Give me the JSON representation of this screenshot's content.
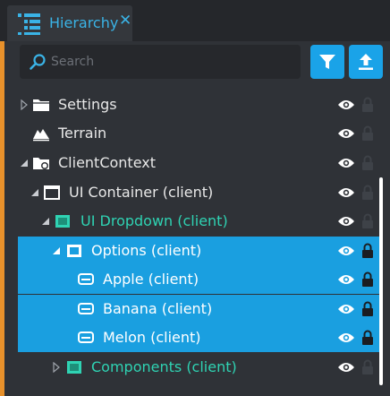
{
  "tab": {
    "title": "Hierarchy",
    "close_label": "✕"
  },
  "search": {
    "placeholder": "Search"
  },
  "toolbar": {
    "filter_icon": "filter-icon",
    "upload_icon": "upload-icon"
  },
  "colors": {
    "accent": "#e8912b",
    "selection": "#1a9fe0",
    "teal_text": "#2fd3b3",
    "blue_text": "#3ab3e6"
  },
  "tree": [
    {
      "label": "Settings",
      "icon": "folder-icon",
      "expander": "collapsed",
      "selected": false,
      "locked": false
    },
    {
      "label": "Terrain",
      "icon": "terrain-icon",
      "expander": "none",
      "selected": false,
      "locked": false
    },
    {
      "label": "ClientContext",
      "icon": "client-context-icon",
      "expander": "expanded",
      "selected": false,
      "locked": false
    },
    {
      "label": "UI Container (client)",
      "icon": "window-icon",
      "expander": "expanded",
      "selected": false,
      "locked": false
    },
    {
      "label": "UI Dropdown (client)",
      "icon": "dropdown-icon",
      "expander": "expanded",
      "selected": false,
      "locked": false
    },
    {
      "label": "Options (client)",
      "icon": "panel-icon",
      "expander": "expanded",
      "selected": true,
      "locked": true
    },
    {
      "label": "Apple (client)",
      "icon": "button-icon",
      "expander": "none",
      "selected": true,
      "locked": true
    },
    {
      "label": "Banana (client)",
      "icon": "button-icon",
      "expander": "none",
      "selected": true,
      "locked": true
    },
    {
      "label": "Melon (client)",
      "icon": "button-icon",
      "expander": "none",
      "selected": true,
      "locked": true
    },
    {
      "label": "Components (client)",
      "icon": "panel-icon",
      "expander": "collapsed",
      "selected": false,
      "locked": false
    }
  ]
}
